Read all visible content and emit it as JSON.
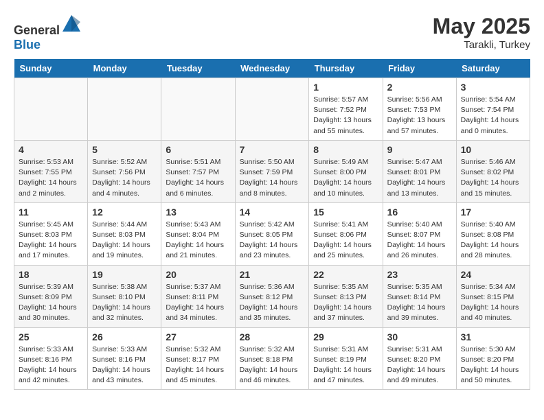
{
  "header": {
    "logo_general": "General",
    "logo_blue": "Blue",
    "month_year": "May 2025",
    "location": "Tarakli, Turkey"
  },
  "weekdays": [
    "Sunday",
    "Monday",
    "Tuesday",
    "Wednesday",
    "Thursday",
    "Friday",
    "Saturday"
  ],
  "weeks": [
    [
      {
        "day": "",
        "detail": ""
      },
      {
        "day": "",
        "detail": ""
      },
      {
        "day": "",
        "detail": ""
      },
      {
        "day": "",
        "detail": ""
      },
      {
        "day": "1",
        "detail": "Sunrise: 5:57 AM\nSunset: 7:52 PM\nDaylight: 13 hours\nand 55 minutes."
      },
      {
        "day": "2",
        "detail": "Sunrise: 5:56 AM\nSunset: 7:53 PM\nDaylight: 13 hours\nand 57 minutes."
      },
      {
        "day": "3",
        "detail": "Sunrise: 5:54 AM\nSunset: 7:54 PM\nDaylight: 14 hours\nand 0 minutes."
      }
    ],
    [
      {
        "day": "4",
        "detail": "Sunrise: 5:53 AM\nSunset: 7:55 PM\nDaylight: 14 hours\nand 2 minutes."
      },
      {
        "day": "5",
        "detail": "Sunrise: 5:52 AM\nSunset: 7:56 PM\nDaylight: 14 hours\nand 4 minutes."
      },
      {
        "day": "6",
        "detail": "Sunrise: 5:51 AM\nSunset: 7:57 PM\nDaylight: 14 hours\nand 6 minutes."
      },
      {
        "day": "7",
        "detail": "Sunrise: 5:50 AM\nSunset: 7:59 PM\nDaylight: 14 hours\nand 8 minutes."
      },
      {
        "day": "8",
        "detail": "Sunrise: 5:49 AM\nSunset: 8:00 PM\nDaylight: 14 hours\nand 10 minutes."
      },
      {
        "day": "9",
        "detail": "Sunrise: 5:47 AM\nSunset: 8:01 PM\nDaylight: 14 hours\nand 13 minutes."
      },
      {
        "day": "10",
        "detail": "Sunrise: 5:46 AM\nSunset: 8:02 PM\nDaylight: 14 hours\nand 15 minutes."
      }
    ],
    [
      {
        "day": "11",
        "detail": "Sunrise: 5:45 AM\nSunset: 8:03 PM\nDaylight: 14 hours\nand 17 minutes."
      },
      {
        "day": "12",
        "detail": "Sunrise: 5:44 AM\nSunset: 8:03 PM\nDaylight: 14 hours\nand 19 minutes."
      },
      {
        "day": "13",
        "detail": "Sunrise: 5:43 AM\nSunset: 8:04 PM\nDaylight: 14 hours\nand 21 minutes."
      },
      {
        "day": "14",
        "detail": "Sunrise: 5:42 AM\nSunset: 8:05 PM\nDaylight: 14 hours\nand 23 minutes."
      },
      {
        "day": "15",
        "detail": "Sunrise: 5:41 AM\nSunset: 8:06 PM\nDaylight: 14 hours\nand 25 minutes."
      },
      {
        "day": "16",
        "detail": "Sunrise: 5:40 AM\nSunset: 8:07 PM\nDaylight: 14 hours\nand 26 minutes."
      },
      {
        "day": "17",
        "detail": "Sunrise: 5:40 AM\nSunset: 8:08 PM\nDaylight: 14 hours\nand 28 minutes."
      }
    ],
    [
      {
        "day": "18",
        "detail": "Sunrise: 5:39 AM\nSunset: 8:09 PM\nDaylight: 14 hours\nand 30 minutes."
      },
      {
        "day": "19",
        "detail": "Sunrise: 5:38 AM\nSunset: 8:10 PM\nDaylight: 14 hours\nand 32 minutes."
      },
      {
        "day": "20",
        "detail": "Sunrise: 5:37 AM\nSunset: 8:11 PM\nDaylight: 14 hours\nand 34 minutes."
      },
      {
        "day": "21",
        "detail": "Sunrise: 5:36 AM\nSunset: 8:12 PM\nDaylight: 14 hours\nand 35 minutes."
      },
      {
        "day": "22",
        "detail": "Sunrise: 5:35 AM\nSunset: 8:13 PM\nDaylight: 14 hours\nand 37 minutes."
      },
      {
        "day": "23",
        "detail": "Sunrise: 5:35 AM\nSunset: 8:14 PM\nDaylight: 14 hours\nand 39 minutes."
      },
      {
        "day": "24",
        "detail": "Sunrise: 5:34 AM\nSunset: 8:15 PM\nDaylight: 14 hours\nand 40 minutes."
      }
    ],
    [
      {
        "day": "25",
        "detail": "Sunrise: 5:33 AM\nSunset: 8:16 PM\nDaylight: 14 hours\nand 42 minutes."
      },
      {
        "day": "26",
        "detail": "Sunrise: 5:33 AM\nSunset: 8:16 PM\nDaylight: 14 hours\nand 43 minutes."
      },
      {
        "day": "27",
        "detail": "Sunrise: 5:32 AM\nSunset: 8:17 PM\nDaylight: 14 hours\nand 45 minutes."
      },
      {
        "day": "28",
        "detail": "Sunrise: 5:32 AM\nSunset: 8:18 PM\nDaylight: 14 hours\nand 46 minutes."
      },
      {
        "day": "29",
        "detail": "Sunrise: 5:31 AM\nSunset: 8:19 PM\nDaylight: 14 hours\nand 47 minutes."
      },
      {
        "day": "30",
        "detail": "Sunrise: 5:31 AM\nSunset: 8:20 PM\nDaylight: 14 hours\nand 49 minutes."
      },
      {
        "day": "31",
        "detail": "Sunrise: 5:30 AM\nSunset: 8:20 PM\nDaylight: 14 hours\nand 50 minutes."
      }
    ]
  ]
}
